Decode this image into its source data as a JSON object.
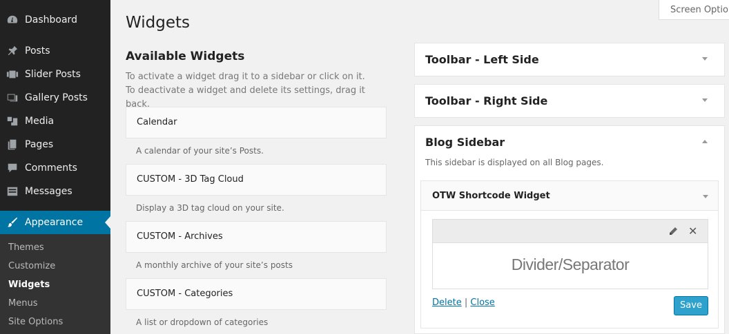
{
  "sidebar": {
    "items": [
      {
        "label": "Dashboard",
        "icon": "dashboard-icon"
      },
      {
        "label": "Posts",
        "icon": "pin-icon"
      },
      {
        "label": "Slider Posts",
        "icon": "slider-icon"
      },
      {
        "label": "Gallery Posts",
        "icon": "gallery-icon"
      },
      {
        "label": "Media",
        "icon": "media-icon"
      },
      {
        "label": "Pages",
        "icon": "pages-icon"
      },
      {
        "label": "Comments",
        "icon": "comments-icon"
      },
      {
        "label": "Messages",
        "icon": "messages-icon"
      },
      {
        "label": "Appearance",
        "icon": "brush-icon"
      }
    ],
    "submenu": [
      "Themes",
      "Customize",
      "Widgets",
      "Menus",
      "Site Options"
    ],
    "current_submenu": "Widgets"
  },
  "header": {
    "title": "Widgets",
    "screen_options": "Screen Options"
  },
  "available": {
    "title": "Available Widgets",
    "description": "To activate a widget drag it to a sidebar or click on it. To deactivate a widget and delete its settings, drag it back.",
    "widgets": [
      {
        "name": "Calendar",
        "desc": "A calendar of your site’s Posts."
      },
      {
        "name": "CUSTOM - 3D Tag Cloud",
        "desc": "Display a 3D tag cloud on your site."
      },
      {
        "name": "CUSTOM - Archives",
        "desc": "A monthly archive of your site’s posts"
      },
      {
        "name": "CUSTOM - Categories",
        "desc": "A list or dropdown of categories"
      }
    ]
  },
  "sidebars": {
    "left": {
      "title": "Toolbar - Left Side"
    },
    "right": {
      "title": "Toolbar - Right Side"
    },
    "blog": {
      "title": "Blog Sidebar",
      "description": "This sidebar is displayed on all Blog pages.",
      "widget": {
        "title": "OTW Shortcode Widget",
        "shortcode": "Divider/Separator",
        "delete_label": "Delete",
        "separator": "|",
        "close_label": "Close",
        "save_label": "Save"
      }
    }
  },
  "colors": {
    "accent": "#0074a2",
    "button": "#2ea2cc",
    "sidebar_bg": "#222222"
  }
}
